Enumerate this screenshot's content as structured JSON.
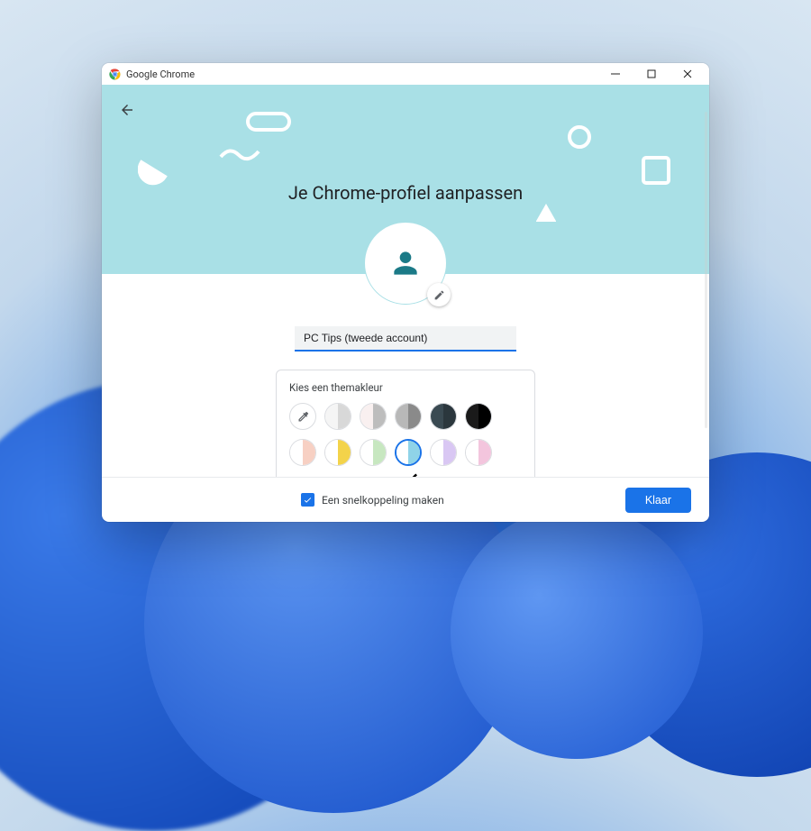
{
  "window": {
    "title": "Google Chrome"
  },
  "hero": {
    "title": "Je Chrome-profiel aanpassen"
  },
  "profile": {
    "name_value": "PC Tips (tweede account)"
  },
  "theme": {
    "label": "Kies een themakleur",
    "swatches_row1": [
      {
        "kind": "picker"
      },
      {
        "left": "#f5f5f5",
        "right": "#d8d8d8"
      },
      {
        "left": "#f9f0f0",
        "right": "#bdbdbd"
      },
      {
        "left": "#b8b8b8",
        "right": "#8a8a8a"
      },
      {
        "left": "#3a4a52",
        "right": "#2b373d"
      },
      {
        "left": "#1a1a1a",
        "right": "#000000"
      }
    ],
    "swatches_row2": [
      {
        "left": "#ffffff",
        "right": "#f7d0c3"
      },
      {
        "left": "#ffffff",
        "right": "#f3d34a"
      },
      {
        "left": "#ffffff",
        "right": "#c7e7c0"
      },
      {
        "left": "#ffffff",
        "right": "#8fd3e8",
        "selected": true
      },
      {
        "left": "#ffffff",
        "right": "#d9c7f3"
      },
      {
        "left": "#ffffff",
        "right": "#f3c5dd"
      }
    ]
  },
  "footer": {
    "shortcut_label": "Een snelkoppeling maken",
    "shortcut_checked": true,
    "done_label": "Klaar"
  }
}
